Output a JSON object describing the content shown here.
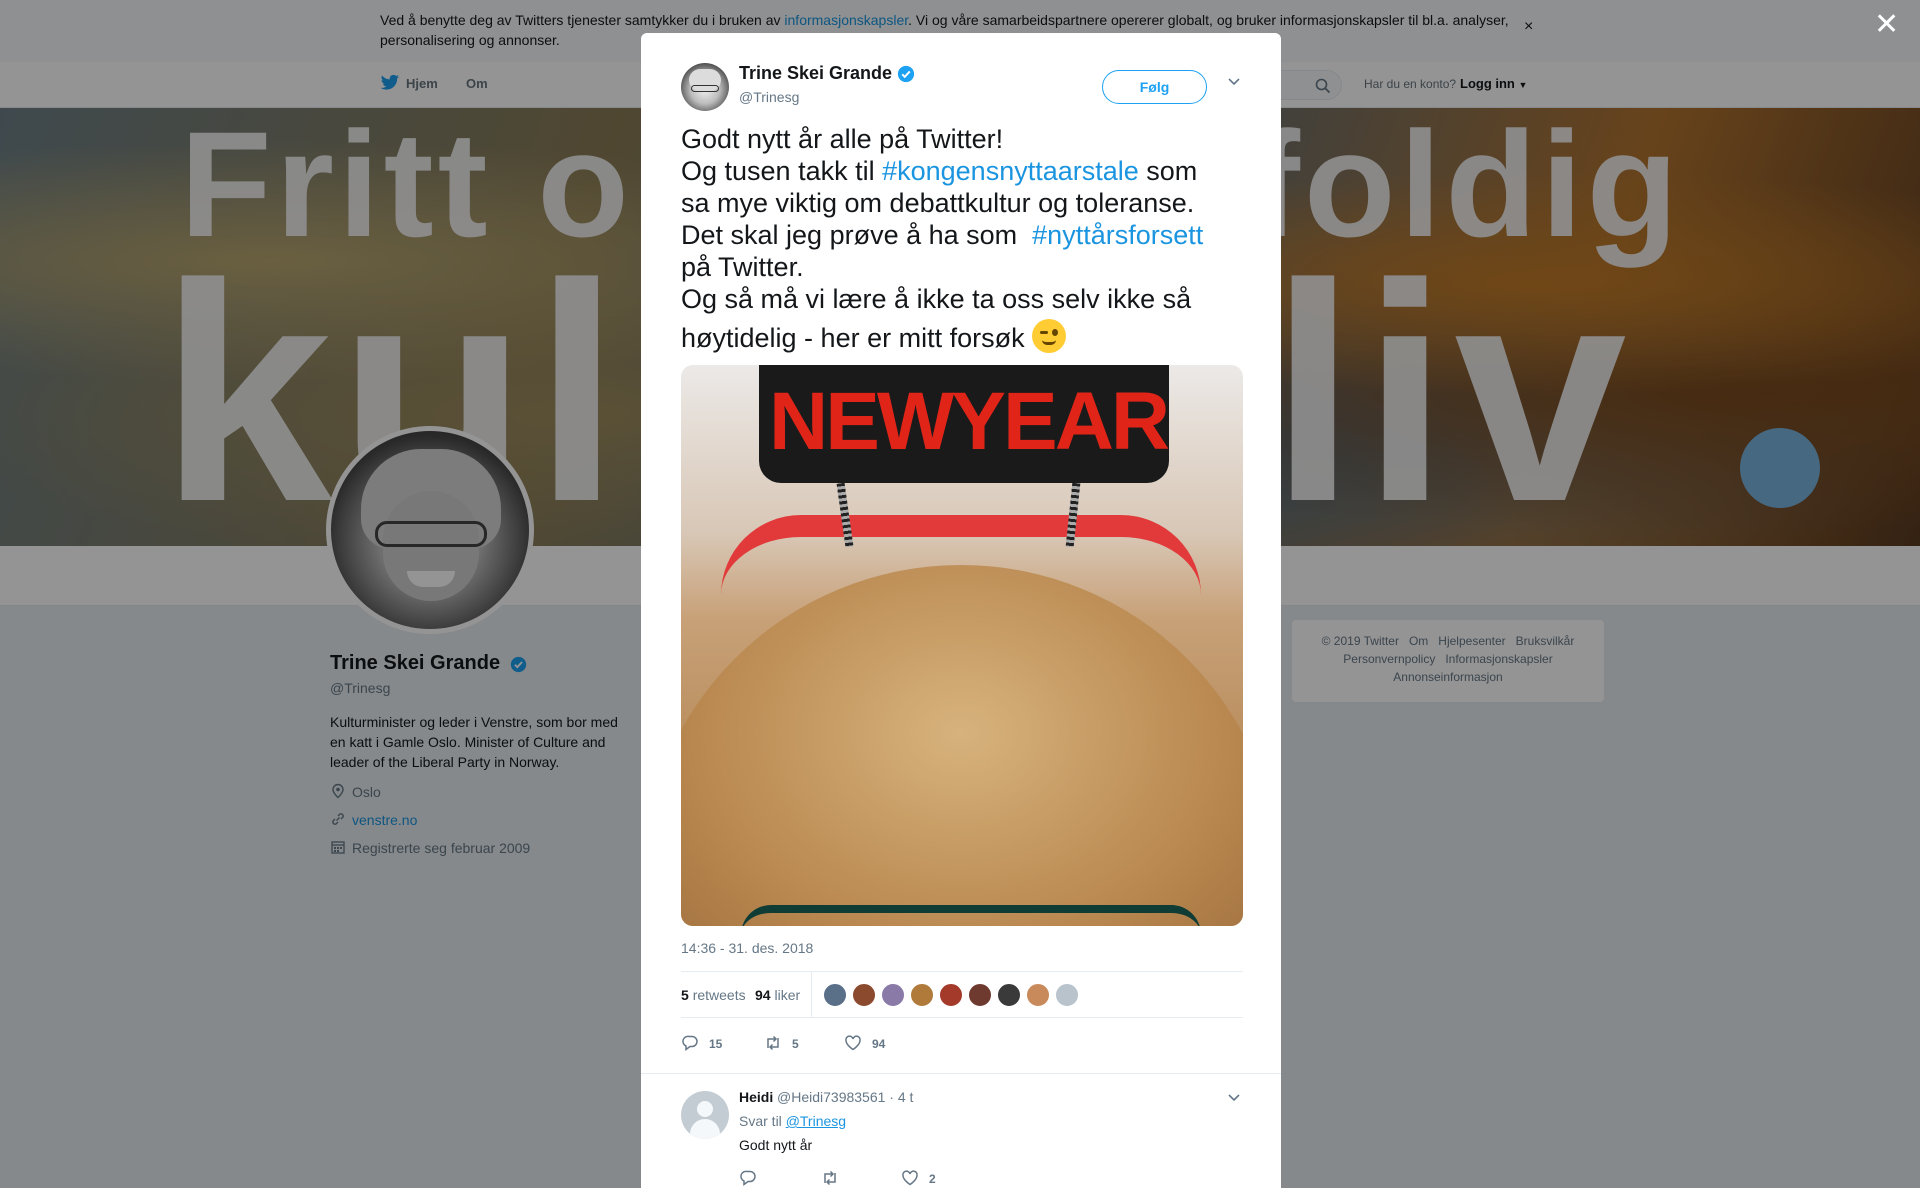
{
  "cookie": {
    "text_before": "Ved å benytte deg av Twitters tjenester samtykker du i bruken av ",
    "link": "informasjonskapsler",
    "text_after": ". Vi og våre samarbeidspartnere opererer globalt, og bruker informasjonskapsler til bl.a. analyser, personalisering og annonser.",
    "close": "×"
  },
  "nav": {
    "home": "Hjem",
    "about": "Om",
    "account_prompt": "Har du en konto?",
    "login": "Logg inn"
  },
  "overlay": {
    "close": "✕"
  },
  "profile": {
    "name": "Trine Skei Grande",
    "handle": "@Trinesg",
    "bio": "Kulturminister og leder i Venstre, som bor med en katt i Gamle Oslo. Minister of Culture and leader of the Liberal Party in Norway.",
    "location": "Oslo",
    "website": "venstre.no",
    "joined": "Registrerte seg februar 2009"
  },
  "footer": {
    "line1": [
      "© 2019 Twitter",
      "Om",
      "Hjelpesenter",
      "Bruksvilkår"
    ],
    "line2": [
      "Personvernpolicy",
      "Informasjonskapsler"
    ],
    "line3": [
      "Annonseinformasjon"
    ]
  },
  "tweet": {
    "author_name": "Trine Skei Grande",
    "author_handle": "@Trinesg",
    "follow_label": "Følg",
    "text": {
      "l1": "Godt nytt år alle på Twitter!",
      "l2_pre": "Og tusen takk til ",
      "l2_tag": "#kongensnyttaarstale",
      "l2_post": " som",
      "l3": "sa mye viktig om debattkultur og toleranse.",
      "l4_pre": "Det skal jeg prøve å ha som  ",
      "l4_tag": "#nyttårsforsett",
      "l5": "på Twitter.",
      "l6": "Og så må vi lære å ikke ta oss selv ikke så",
      "l7": "høytidelig - her er mitt forsøk "
    },
    "photo_sign": "NEWYEAR",
    "timestamp": "14:36 - 31. des. 2018",
    "retweets_count": "5",
    "retweets_label": "retweets",
    "likes_count": "94",
    "likes_label": "liker",
    "action_replies": "15",
    "action_retweets": "5",
    "action_likes": "94"
  },
  "reply": {
    "name": "Heidi",
    "handle_time": "@Heidi73983561 · 4 t",
    "reply_to_label": "Svar til ",
    "reply_to_handle": "@Trinesg",
    "text": "Godt nytt år",
    "likes": "2"
  },
  "colors": {
    "link": "#1b95e0",
    "accent": "#1da1f2",
    "verified": "#1da1f2"
  },
  "icons": [
    "twitter-bird-icon",
    "search-icon",
    "verified-icon",
    "location-icon",
    "link-icon",
    "calendar-icon",
    "chevron-down-icon",
    "reply-icon",
    "retweet-icon",
    "heart-icon",
    "close-icon",
    "winking-face-emoji"
  ]
}
